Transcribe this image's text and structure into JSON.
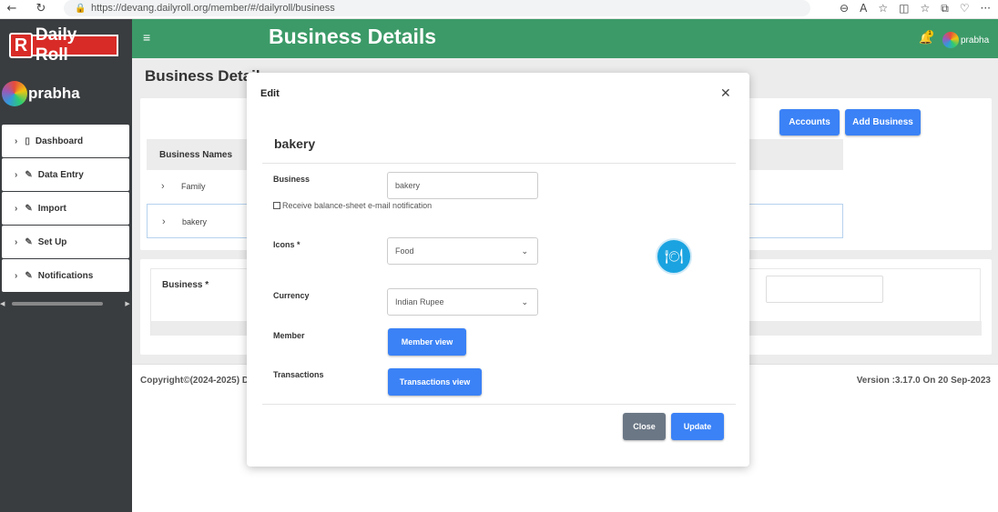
{
  "browser": {
    "url": "https://devang.dailyroll.org/member/#/dailyroll/business"
  },
  "sidebar": {
    "logo_letter": "R",
    "logo_text": "Daily Roll",
    "user_name": "prabha",
    "items": [
      {
        "label": "Dashboard",
        "icon": "file-icon"
      },
      {
        "label": "Data Entry",
        "icon": "pencil-icon"
      },
      {
        "label": "Import",
        "icon": "pencil-icon"
      },
      {
        "label": "Set Up",
        "icon": "pencil-icon"
      },
      {
        "label": "Notifications",
        "icon": "pencil-icon"
      }
    ]
  },
  "topbar": {
    "title": "Business Details",
    "bell_count": "1",
    "user_name": "prabha"
  },
  "page": {
    "title": "Business Details",
    "accounts_button": "Accounts",
    "add_business_button": "Add Business",
    "table_header": "Business Names",
    "rows": [
      "Family",
      "bakery"
    ],
    "business_label": "Business *"
  },
  "footer": {
    "copyright": "Copyright©(2024-2025) Da",
    "version": "Version :3.17.0 On 20 Sep-2023"
  },
  "modal": {
    "title": "Edit",
    "subtitle": "bakery",
    "business_label": "Business",
    "business_value": "bakery",
    "checkbox_label": "Receive balance-sheet e-mail notification",
    "checkbox_checked": false,
    "icons_label": "Icons *",
    "icons_value": "Food",
    "currency_label": "Currency",
    "currency_value": "Indian Rupee",
    "member_label": "Member",
    "member_button": "Member view",
    "transactions_label": "Transactions",
    "transactions_button": "Transactions view",
    "close_button": "Close",
    "update_button": "Update",
    "icon_name": "plate-cutlery-icon"
  },
  "colors": {
    "topbar": "#3c9a68",
    "sidebar": "#3a3d40",
    "primary": "#3b82f6",
    "secondary": "#6b7785",
    "food_icon": "#1aa3e0"
  }
}
